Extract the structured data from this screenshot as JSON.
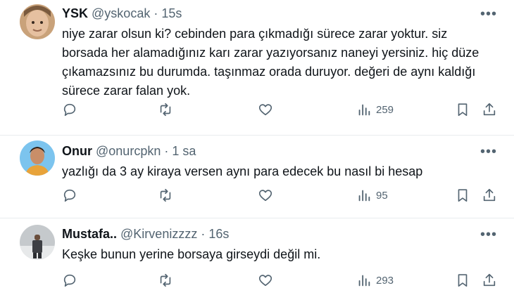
{
  "tweets": [
    {
      "name": "YSK",
      "handle": "@yskocak",
      "time": "15s",
      "lines": [
        "niye zarar olsun ki? cebinden para çıkmadığı sürece zarar yoktur. siz",
        "borsada her alamadığınız karı zarar yazıyorsanız  naneyi yersiniz. hiç düze",
        "çıkamazsınız bu durumda. taşınmaz orada duruyor. değeri de aynı kaldığı",
        "sürece zarar falan yok."
      ],
      "views": "259"
    },
    {
      "name": "Onur",
      "handle": "@onurcpkn",
      "time": "1 sa",
      "lines": [
        "yazlığı da 3 ay kiraya versen aynı para edecek bu nasıl bi hesap"
      ],
      "views": "95"
    },
    {
      "name": "Mustafa..",
      "handle": "@Kirvenizzzz",
      "time": "16s",
      "lines": [
        "Keşke bunun yerine borsaya girseydi değil mi."
      ],
      "views": "293"
    }
  ],
  "ui": {
    "dot": "·",
    "more": "•••"
  },
  "colors": {
    "text": "#0f1419",
    "secondary": "#536471",
    "divider": "#e9ecee"
  }
}
